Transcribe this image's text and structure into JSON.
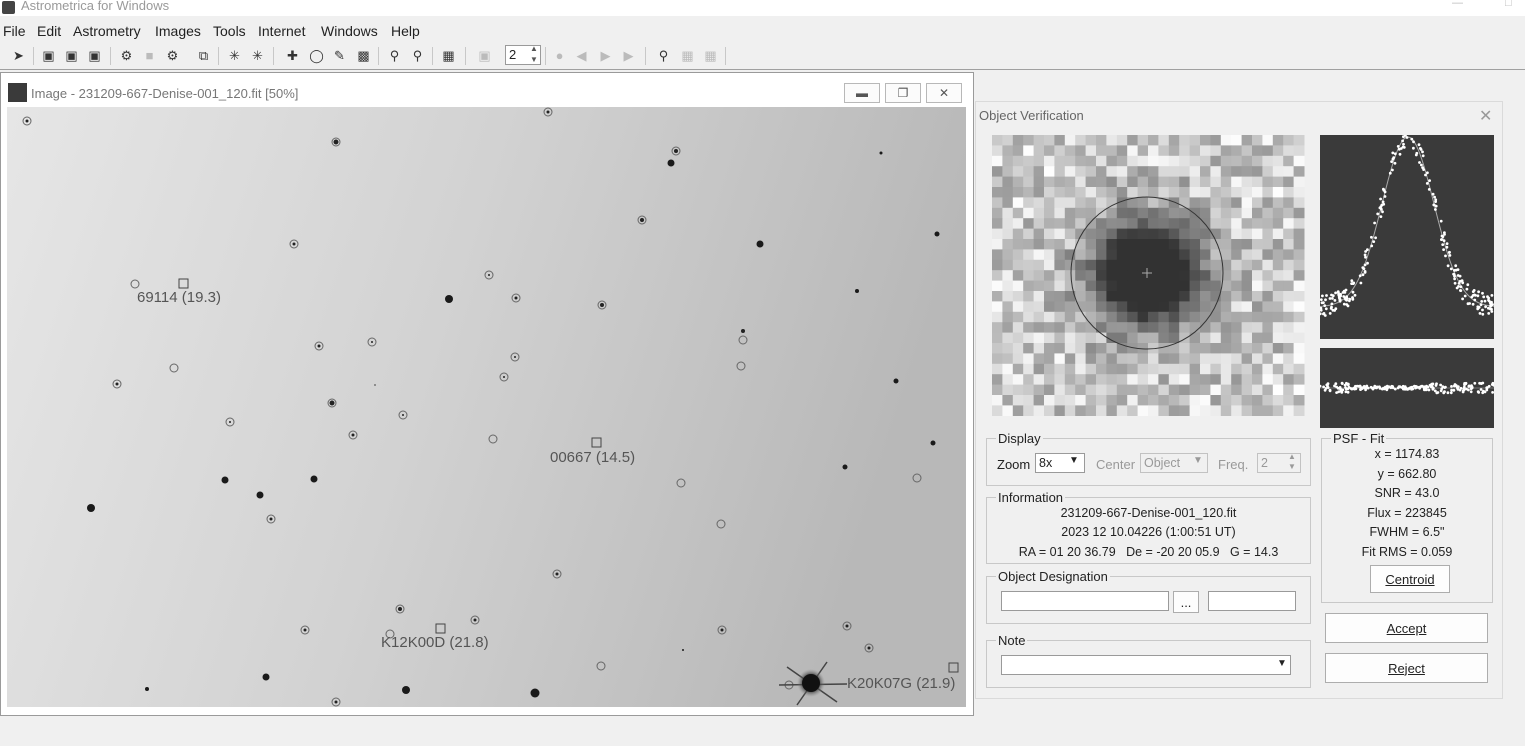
{
  "app": {
    "title": "Astrometrica for Windows"
  },
  "menu": [
    {
      "key": "file",
      "label": "File"
    },
    {
      "key": "edit",
      "label": "Edit"
    },
    {
      "key": "astrometry",
      "label": "Astrometry"
    },
    {
      "key": "images",
      "label": "Images"
    },
    {
      "key": "tools",
      "label": "Tools"
    },
    {
      "key": "internet",
      "label": "Internet"
    },
    {
      "key": "windows",
      "label": "Windows"
    },
    {
      "key": "help",
      "label": "Help"
    }
  ],
  "toolbar": {
    "blink_frame_value": "2"
  },
  "image_window": {
    "title": "Image - 231209-667-Denise-001_120.fit [50%]",
    "labels": {
      "obj1": "69114 (19.3)",
      "obj2": "00667 (14.5)",
      "obj3": "K12K00D (21.8)",
      "obj4": "K20K07G (21.9)"
    }
  },
  "verification": {
    "title": "Object Verification",
    "display": {
      "group_label": "Display",
      "zoom_label": "Zoom",
      "zoom_value": "8x",
      "center_label": "Center",
      "center_value": "Object",
      "freq_label": "Freq.",
      "freq_value": "2"
    },
    "information": {
      "group_label": "Information",
      "filename": "231209-667-Denise-001_120.fit",
      "datetime": "2023 12 10.04226 (1:00:51 UT)",
      "coords": "RA = 01 20 36.79   De = -20 20 05.9   G = 14.3"
    },
    "designation": {
      "group_label": "Object Designation",
      "button_label": "...",
      "value1": "",
      "value2": ""
    },
    "note": {
      "group_label": "Note",
      "value": ""
    },
    "psf": {
      "group_label": "PSF - Fit",
      "x": "x = 1174.83",
      "y": "y = 662.80",
      "snr": "SNR = 43.0",
      "flux": "Flux = 223845",
      "fwhm": "FWHM = 6.5\"",
      "rms": "Fit RMS = 0.059",
      "centroid_label": "Centroid"
    },
    "accept_label": "Accept",
    "reject_label": "Reject"
  },
  "icons": {
    "toolbar": [
      "telescope-icon",
      "open-icon",
      "open-multiple-icon",
      "open-all-icon",
      "settings-icon",
      "stop-icon",
      "image-settings-icon",
      "copy-icon",
      "star-icon",
      "star-remove-icon",
      "crosshair-icon",
      "circle-icon",
      "edit-icon",
      "dark-icon",
      "zoom-in-icon",
      "zoom-out-icon",
      "stack-icon",
      "blink-icon",
      "record-icon",
      "back-icon",
      "play-icon",
      "forward-icon",
      "search-icon",
      "grid-icon",
      "grid-alt-icon"
    ]
  }
}
